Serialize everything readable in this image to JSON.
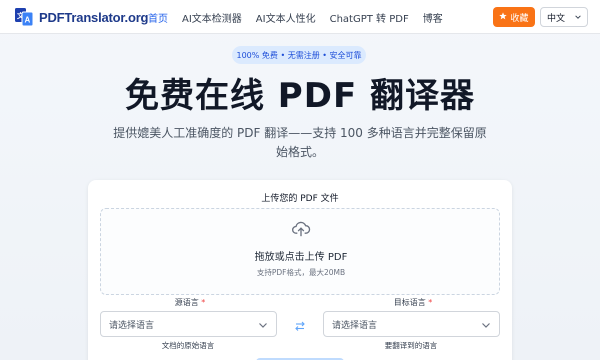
{
  "nav": {
    "logo_text": "PDFTranslator.org",
    "links": [
      {
        "label": "首页",
        "active": true
      },
      {
        "label": "AI文本检测器",
        "active": false
      },
      {
        "label": "AI文本人性化",
        "active": false
      },
      {
        "label": "ChatGPT 转 PDF",
        "active": false
      },
      {
        "label": "博客",
        "active": false
      }
    ],
    "favorite_label": "收藏",
    "language_value": "中文"
  },
  "hero": {
    "badge": "100% 免费 • 无需注册 • 安全可靠",
    "title": "免费在线 PDF 翻译器",
    "subtitle": "提供媲美人工准确度的 PDF 翻译——支持 100 多种语言并完整保留原始格式。"
  },
  "upload": {
    "label": "上传您的 PDF 文件",
    "drop_text": "拖放或点击上传 PDF",
    "hint": "支持PDF格式，最大20MB"
  },
  "source": {
    "label": "源语言",
    "required_mark": "*",
    "placeholder": "请选择语言",
    "help": "文档的原始语言"
  },
  "target": {
    "label": "目标语言",
    "required_mark": "*",
    "placeholder": "请选择语言",
    "help": "要翻译到的语言"
  },
  "colors": {
    "accent": "#2563eb",
    "favorite": "#f97316",
    "badge_bg": "#dbeafe"
  },
  "icons": {
    "logo": "pdf-translate-icon",
    "favorite": "star-icon",
    "upload": "cloud-upload-icon",
    "swap": "swap-arrows-icon",
    "dropdown": "chevron-down-icon"
  }
}
